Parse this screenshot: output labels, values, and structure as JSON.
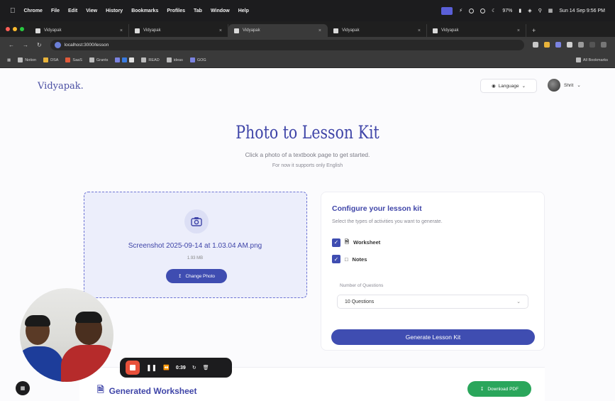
{
  "menubar": {
    "app": "Chrome",
    "items": [
      "File",
      "Edit",
      "View",
      "History",
      "Bookmarks",
      "Profiles",
      "Tab",
      "Window",
      "Help"
    ],
    "battery": "97%",
    "datetime": "Sun 14 Sep  9:56 PM"
  },
  "tabs": [
    {
      "label": "Vidyapak",
      "active": false
    },
    {
      "label": "Vidyapak",
      "active": false
    },
    {
      "label": "Vidyapak",
      "active": true
    },
    {
      "label": "Vidyapak",
      "active": false
    },
    {
      "label": "Vidyapak",
      "active": false
    }
  ],
  "address": {
    "url": "localhost:3000/lesson"
  },
  "bookmarks": {
    "items": [
      "Notion",
      "DSA",
      "SaaS",
      "Grants",
      "READ",
      "ideas",
      "GOG"
    ],
    "all": "All Bookmarks"
  },
  "header": {
    "brand": "Vidyapak.",
    "language": "Language",
    "user": "Shrit"
  },
  "hero": {
    "title": "Photo to Lesson Kit",
    "subtitle": "Click a photo of a textbook page to get started.",
    "note": "For now it supports only English"
  },
  "upload": {
    "filename": "Screenshot 2025-09-14 at 1.03.04 AM.png",
    "filesize": "1.93 MB",
    "change_label": "Change Photo"
  },
  "config": {
    "title": "Configure your lesson kit",
    "description": "Select the types of activities you want to generate.",
    "options": [
      {
        "label": "Worksheet",
        "checked": true
      },
      {
        "label": "Notes",
        "checked": true
      }
    ],
    "questions_label": "Number of Questions",
    "questions_value": "10 Questions",
    "generate_label": "Generate Lesson Kit"
  },
  "generated": {
    "title": "Generated Worksheet",
    "download_label": "Download PDF"
  },
  "recorder": {
    "time": "0:39"
  },
  "colors": {
    "accent": "#3f4db1",
    "brand_text": "#3f45a8",
    "success": "#2aa65b",
    "record": "#e8503a"
  }
}
